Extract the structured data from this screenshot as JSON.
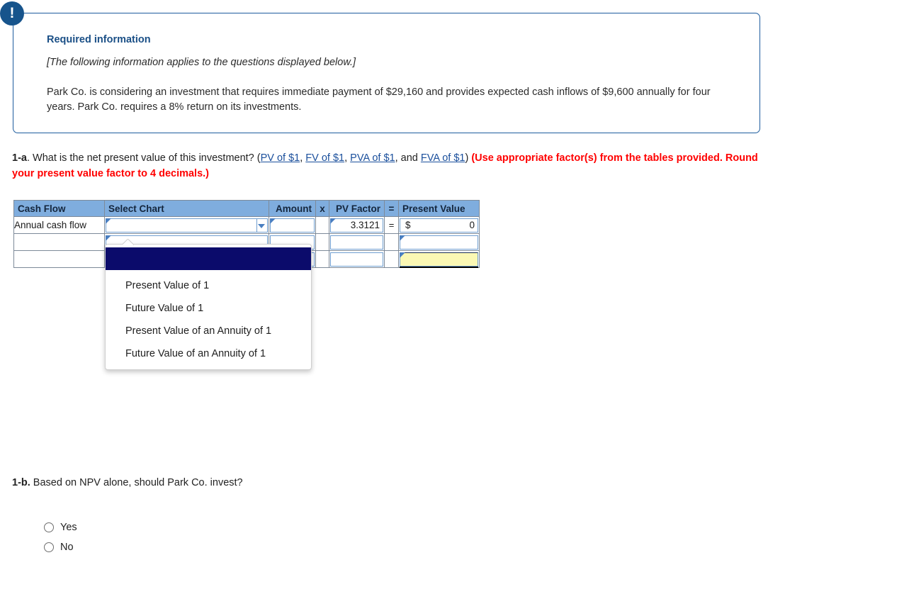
{
  "info_box": {
    "badge": "!",
    "title": "Required information",
    "subtitle": "[The following information applies to the questions displayed below.]",
    "body": "Park Co. is considering an investment that requires immediate payment of $29,160 and provides expected cash inflows of $9,600 annually for four years. Park Co. requires a 8% return on its investments."
  },
  "question_1a": {
    "number": "1-a",
    "text": ". What is the net present value of this investment? (",
    "links": [
      {
        "label": "PV of $1"
      },
      {
        "label": "FV of $1"
      },
      {
        "label": "PVA of $1"
      },
      {
        "label": "FVA of $1"
      }
    ],
    "sep1": ", ",
    "sep2": ", ",
    "sep3": ", and ",
    "close": ") ",
    "instruction": "(Use appropriate factor(s) from the tables provided. Round your present value factor to 4 decimals.)"
  },
  "table": {
    "headers": {
      "cash_flow": "Cash Flow",
      "select_chart": "Select Chart",
      "amount": "Amount",
      "times": "x",
      "pv_factor": "PV Factor",
      "equals": "=",
      "present_value": "Present Value"
    },
    "rows": [
      {
        "cash_flow": "Annual cash flow",
        "select_chart": "",
        "amount": "",
        "times": "",
        "pv_factor": "3.3121",
        "equals": "=",
        "pv_dollar": "$",
        "present_value": "0"
      },
      {
        "cash_flow": "",
        "select_chart": "",
        "amount": "",
        "times": "",
        "pv_factor": "",
        "equals": "",
        "pv_dollar": "",
        "present_value": ""
      },
      {
        "cash_flow": "",
        "select_chart": "",
        "amount": "",
        "times": "",
        "pv_factor": "",
        "equals": "",
        "pv_dollar": "",
        "present_value": ""
      }
    ]
  },
  "dropdown": {
    "selected": "",
    "options": [
      "Present Value of 1",
      "Future Value of 1",
      "Present Value of an Annuity of 1",
      "Future Value of an Annuity of 1"
    ]
  },
  "question_1b": {
    "number": "1-b.",
    "text": " Based on NPV alone, should Park Co. invest?",
    "options": [
      "Yes",
      "No"
    ]
  },
  "colors": {
    "header_blue": "#7fadde",
    "callout_border": "#1d5c9e",
    "callout_title": "#1a4f86",
    "badge_navy": "#17548c",
    "link_blue": "#1a4f9c",
    "instruction_red": "#ff0000",
    "dropdown_selected": "#0b0b6b",
    "total_yellow": "#fbf8b4",
    "cell_border_blue": "#6f9ed0"
  }
}
